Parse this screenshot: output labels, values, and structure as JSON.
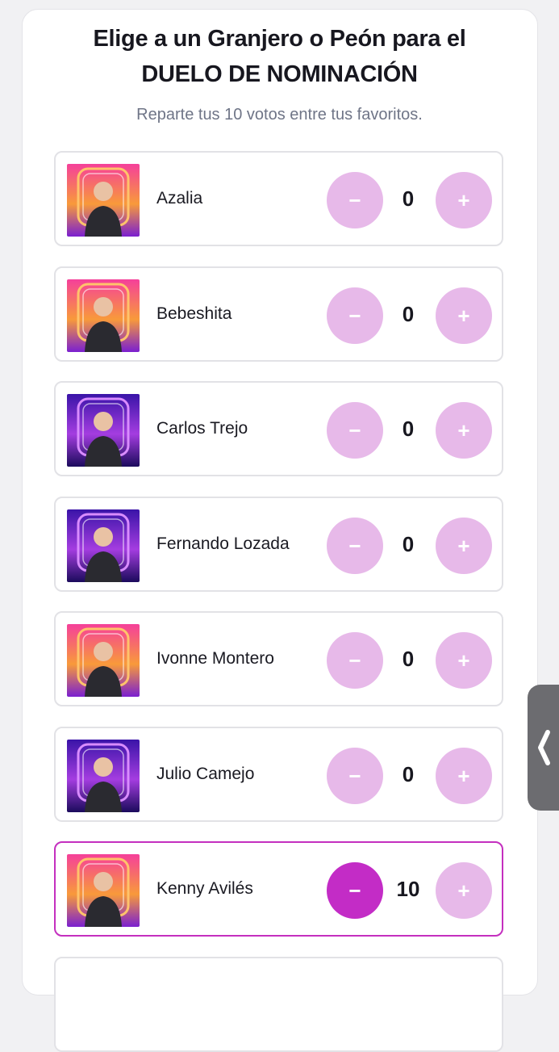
{
  "header": {
    "title_line1": "Elige a un Granjero o Peón para el",
    "title_line2": "DUELO DE NOMINACIÓN",
    "subtitle": "Reparte tus 10 votos entre tus favoritos."
  },
  "controls": {
    "minus_label": "−",
    "plus_label": "+"
  },
  "colors": {
    "accent": "#c32cc6",
    "button_inactive": "#e7b9e9",
    "card_pink": "#f0488e",
    "card_purple": "#6a2ed8"
  },
  "candidates": [
    {
      "name": "Azalia",
      "votes": "0",
      "theme": "pink"
    },
    {
      "name": "Bebeshita",
      "votes": "0",
      "theme": "pink"
    },
    {
      "name": "Carlos Trejo",
      "votes": "0",
      "theme": "purple"
    },
    {
      "name": "Fernando Lozada",
      "votes": "0",
      "theme": "purple"
    },
    {
      "name": "Ivonne Montero",
      "votes": "0",
      "theme": "pink"
    },
    {
      "name": "Julio Camejo",
      "votes": "0",
      "theme": "purple"
    },
    {
      "name": "Kenny Avilés",
      "votes": "10",
      "theme": "pink",
      "selected": true
    }
  ],
  "side_tab": {
    "icon": "chevron-left-icon"
  }
}
